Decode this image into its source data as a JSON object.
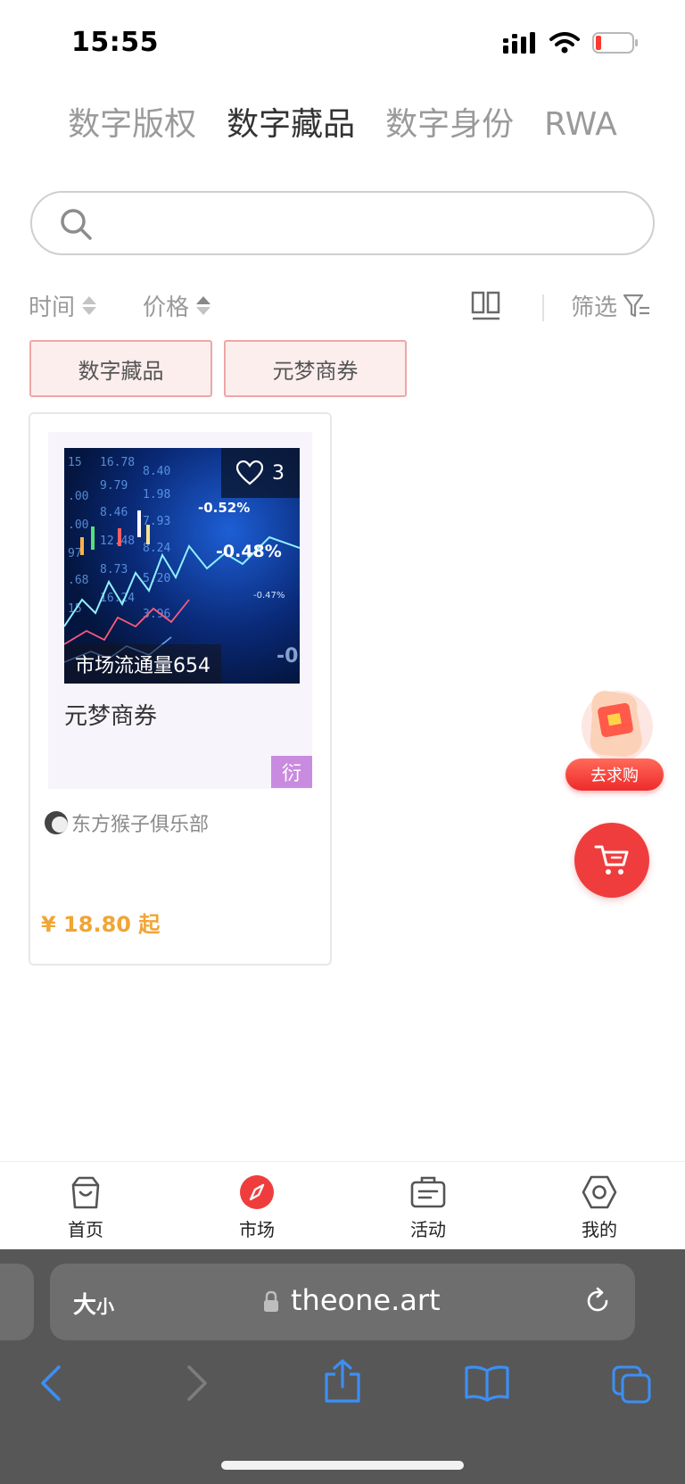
{
  "status_bar": {
    "time": "15:55",
    "icons": [
      "cellular-signal-icon",
      "wifi-icon",
      "battery-low-icon"
    ],
    "battery_color": "#ff3b30"
  },
  "top_tabs": {
    "items": [
      {
        "label": "数字版权",
        "active": false
      },
      {
        "label": "数字藏品",
        "active": true
      },
      {
        "label": "数字身份",
        "active": false
      },
      {
        "label": "RWA",
        "active": false
      }
    ]
  },
  "search": {
    "placeholder": "",
    "value": "",
    "icon": "search-icon"
  },
  "sort_bar": {
    "time_label": "时间",
    "price_label": "价格",
    "filter_label": "筛选",
    "view_icon": "grid-view-icon",
    "filter_icon": "filter-icon"
  },
  "chips": [
    {
      "label": "数字藏品"
    },
    {
      "label": "元梦商券"
    }
  ],
  "product_card": {
    "likes": "3",
    "volume_label": "市场流通量654",
    "title": "元梦商券",
    "tag": "衍",
    "creator": "东方猴子俱乐部",
    "price": "¥ 18.80 起",
    "image_text": {
      "pct1": "-0.52%",
      "pct2": "-0.48%",
      "pct3": "-0.47%"
    }
  },
  "floating": {
    "qiugou_label": "去求购",
    "cart_icon": "cart-icon"
  },
  "bottom_nav": {
    "items": [
      {
        "label": "首页",
        "icon": "shopping-bag-icon",
        "active": false
      },
      {
        "label": "市场",
        "icon": "compass-icon",
        "active": true
      },
      {
        "label": "活动",
        "icon": "ticket-icon",
        "active": false
      },
      {
        "label": "我的",
        "icon": "hexagon-settings-icon",
        "active": false
      }
    ]
  },
  "browser": {
    "text_size_label": "大",
    "text_size_small": "小",
    "url": "theone.art",
    "toolbar_icons": [
      "back-icon",
      "forward-icon",
      "share-icon",
      "bookmarks-icon",
      "tabs-icon"
    ]
  },
  "colors": {
    "accent_red": "#ef3d3d",
    "price_orange": "#f0a535",
    "chip_border": "#f0a6a6",
    "chip_bg": "#fdeeee",
    "tag_purple": "#c98be0",
    "safari_blue": "#3b8ff5"
  }
}
